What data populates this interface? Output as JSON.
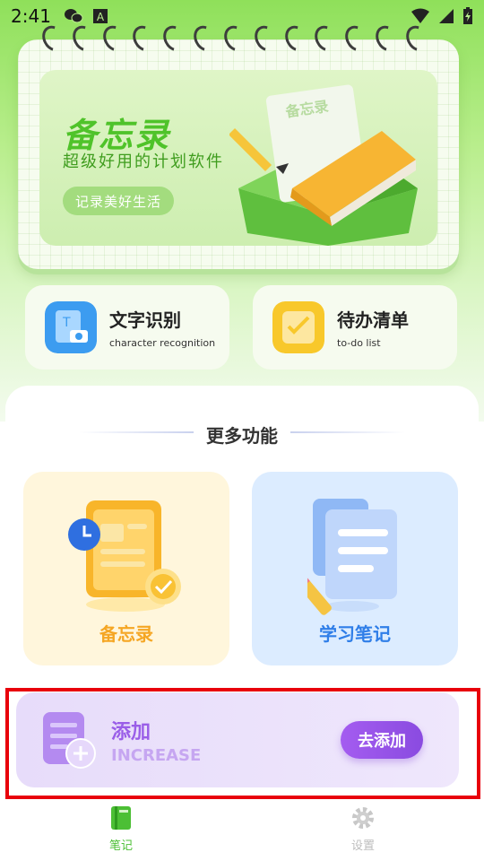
{
  "status_bar": {
    "time": "2:41",
    "icons": [
      "wechat-icon",
      "a-notification-icon",
      "wifi-icon",
      "signal-icon",
      "battery-icon"
    ]
  },
  "banner": {
    "title": "备忘录",
    "subtitle": "超级好用的计划软件",
    "button_label": "记录美好生活",
    "note_label": "备忘录"
  },
  "features": [
    {
      "title": "文字识别",
      "subtitle": "character recognition",
      "icon": "text-recognition-icon"
    },
    {
      "title": "待办清单",
      "subtitle": "to-do list",
      "icon": "todo-list-icon"
    }
  ],
  "more": {
    "section_title": "更多功能",
    "cards": [
      {
        "label": "备忘录",
        "icon": "memo-clipboard-icon"
      },
      {
        "label": "学习笔记",
        "icon": "study-notes-icon"
      }
    ]
  },
  "add_card": {
    "title": "添加",
    "subtitle": "INCREASE",
    "button_label": "去添加",
    "icon": "add-document-icon"
  },
  "bottom_nav": {
    "items": [
      {
        "label": "笔记",
        "icon": "book-icon",
        "active": true
      },
      {
        "label": "设置",
        "icon": "gear-icon",
        "active": false
      }
    ]
  },
  "colors": {
    "accent_green": "#4fc32a",
    "accent_purple": "#9a5ee8",
    "highlight_red": "#e8000b"
  }
}
